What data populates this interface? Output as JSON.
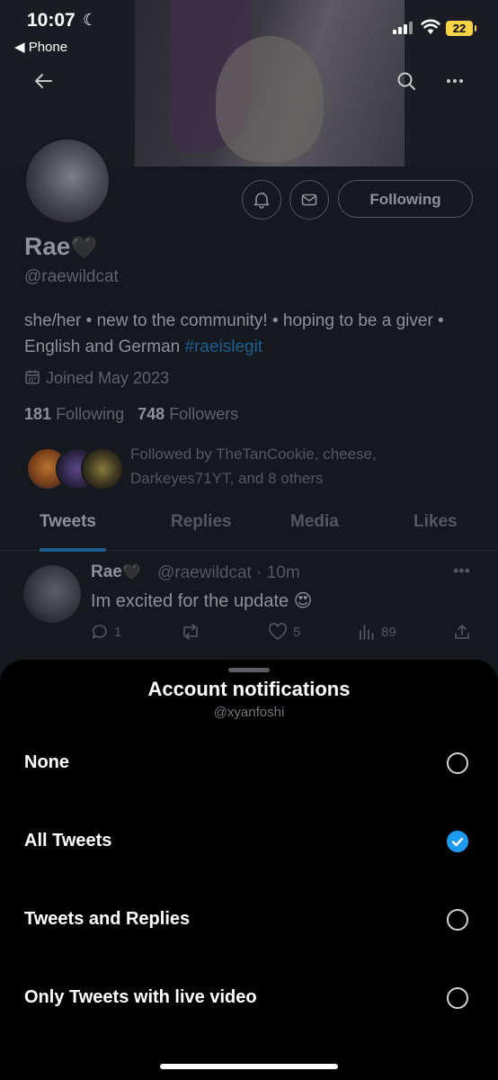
{
  "status_bar": {
    "time": "10:07",
    "back_app": "◀ Phone",
    "battery": "22"
  },
  "profile": {
    "name": "Rae",
    "name_emoji": "🖤",
    "handle": "@raewildcat",
    "bio_text": "she/her • new to the community! • hoping to be a giver • English and German ",
    "bio_hashtag": "#raeislegit",
    "joined": "Joined May 2023",
    "following_count": "181",
    "following_label": "Following",
    "followers_count": "748",
    "followers_label": "Followers",
    "followed_by": "Followed by TheTanCookie, cheese, Darkeyes71YT, and 8 others",
    "following_button": "Following"
  },
  "tabs": [
    {
      "label": "Tweets",
      "active": true
    },
    {
      "label": "Replies",
      "active": false
    },
    {
      "label": "Media",
      "active": false
    },
    {
      "label": "Likes",
      "active": false
    }
  ],
  "tweet": {
    "name": "Rae",
    "name_emoji": "🖤",
    "meta": "@raewildcat · 10m",
    "text": "Im excited for the update 😍",
    "replies": "1",
    "likes": "5",
    "views": "89"
  },
  "sheet": {
    "title": "Account notifications",
    "subtitle": "@xyanfoshi",
    "options": [
      {
        "label": "None",
        "selected": false
      },
      {
        "label": "All Tweets",
        "selected": true
      },
      {
        "label": "Tweets and Replies",
        "selected": false
      },
      {
        "label": "Only Tweets with live video",
        "selected": false
      }
    ]
  },
  "colors": {
    "accent": "#1d9bf0",
    "sheet_bg": "#000000"
  }
}
